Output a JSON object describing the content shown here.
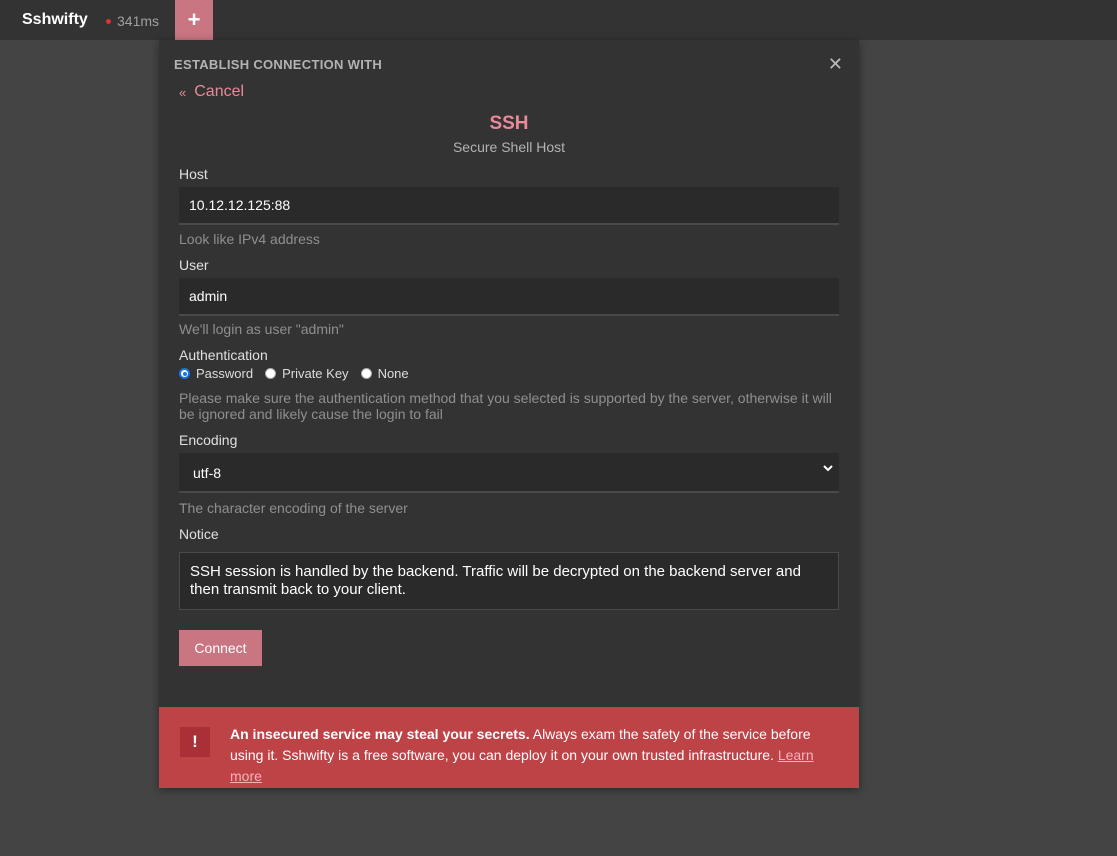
{
  "app": {
    "title": "Sshwifty",
    "latency": "341ms",
    "add_tab_symbol": "+"
  },
  "dialog": {
    "title": "ESTABLISH CONNECTION WITH",
    "close_symbol": "✕",
    "cancel_label": "Cancel",
    "cancel_chevron": "«",
    "protocol_name": "SSH",
    "protocol_description": "Secure Shell Host",
    "host": {
      "label": "Host",
      "value": "10.12.12.125:88",
      "hint": "Look like IPv4 address"
    },
    "user": {
      "label": "User",
      "value": "admin",
      "hint": "We'll login as user \"admin\""
    },
    "authentication": {
      "label": "Authentication",
      "options": [
        "Password",
        "Private Key",
        "None"
      ],
      "selected": "Password",
      "hint": "Please make sure the authentication method that you selected is supported by the server, otherwise it will be ignored and likely cause the login to fail"
    },
    "encoding": {
      "label": "Encoding",
      "value": "utf-8",
      "hint": "The character encoding of the server"
    },
    "notice": {
      "label": "Notice",
      "text": "SSH session is handled by the backend. Traffic will be decrypted on the backend server and then transmit back to your client."
    },
    "connect_label": "Connect"
  },
  "warning": {
    "icon_symbol": "!",
    "bold_text": "An insecured service may steal your secrets.",
    "text": " Always exam the safety of the service before using it. Sshwifty is a free software, you can deploy it on your own trusted infrastructure. ",
    "link_label": "Learn more"
  },
  "colors": {
    "accent": "#e98a9a",
    "button": "#c97582",
    "warning_bg": "#bd4347",
    "dialog_bg": "#333333",
    "page_bg": "#444444"
  }
}
